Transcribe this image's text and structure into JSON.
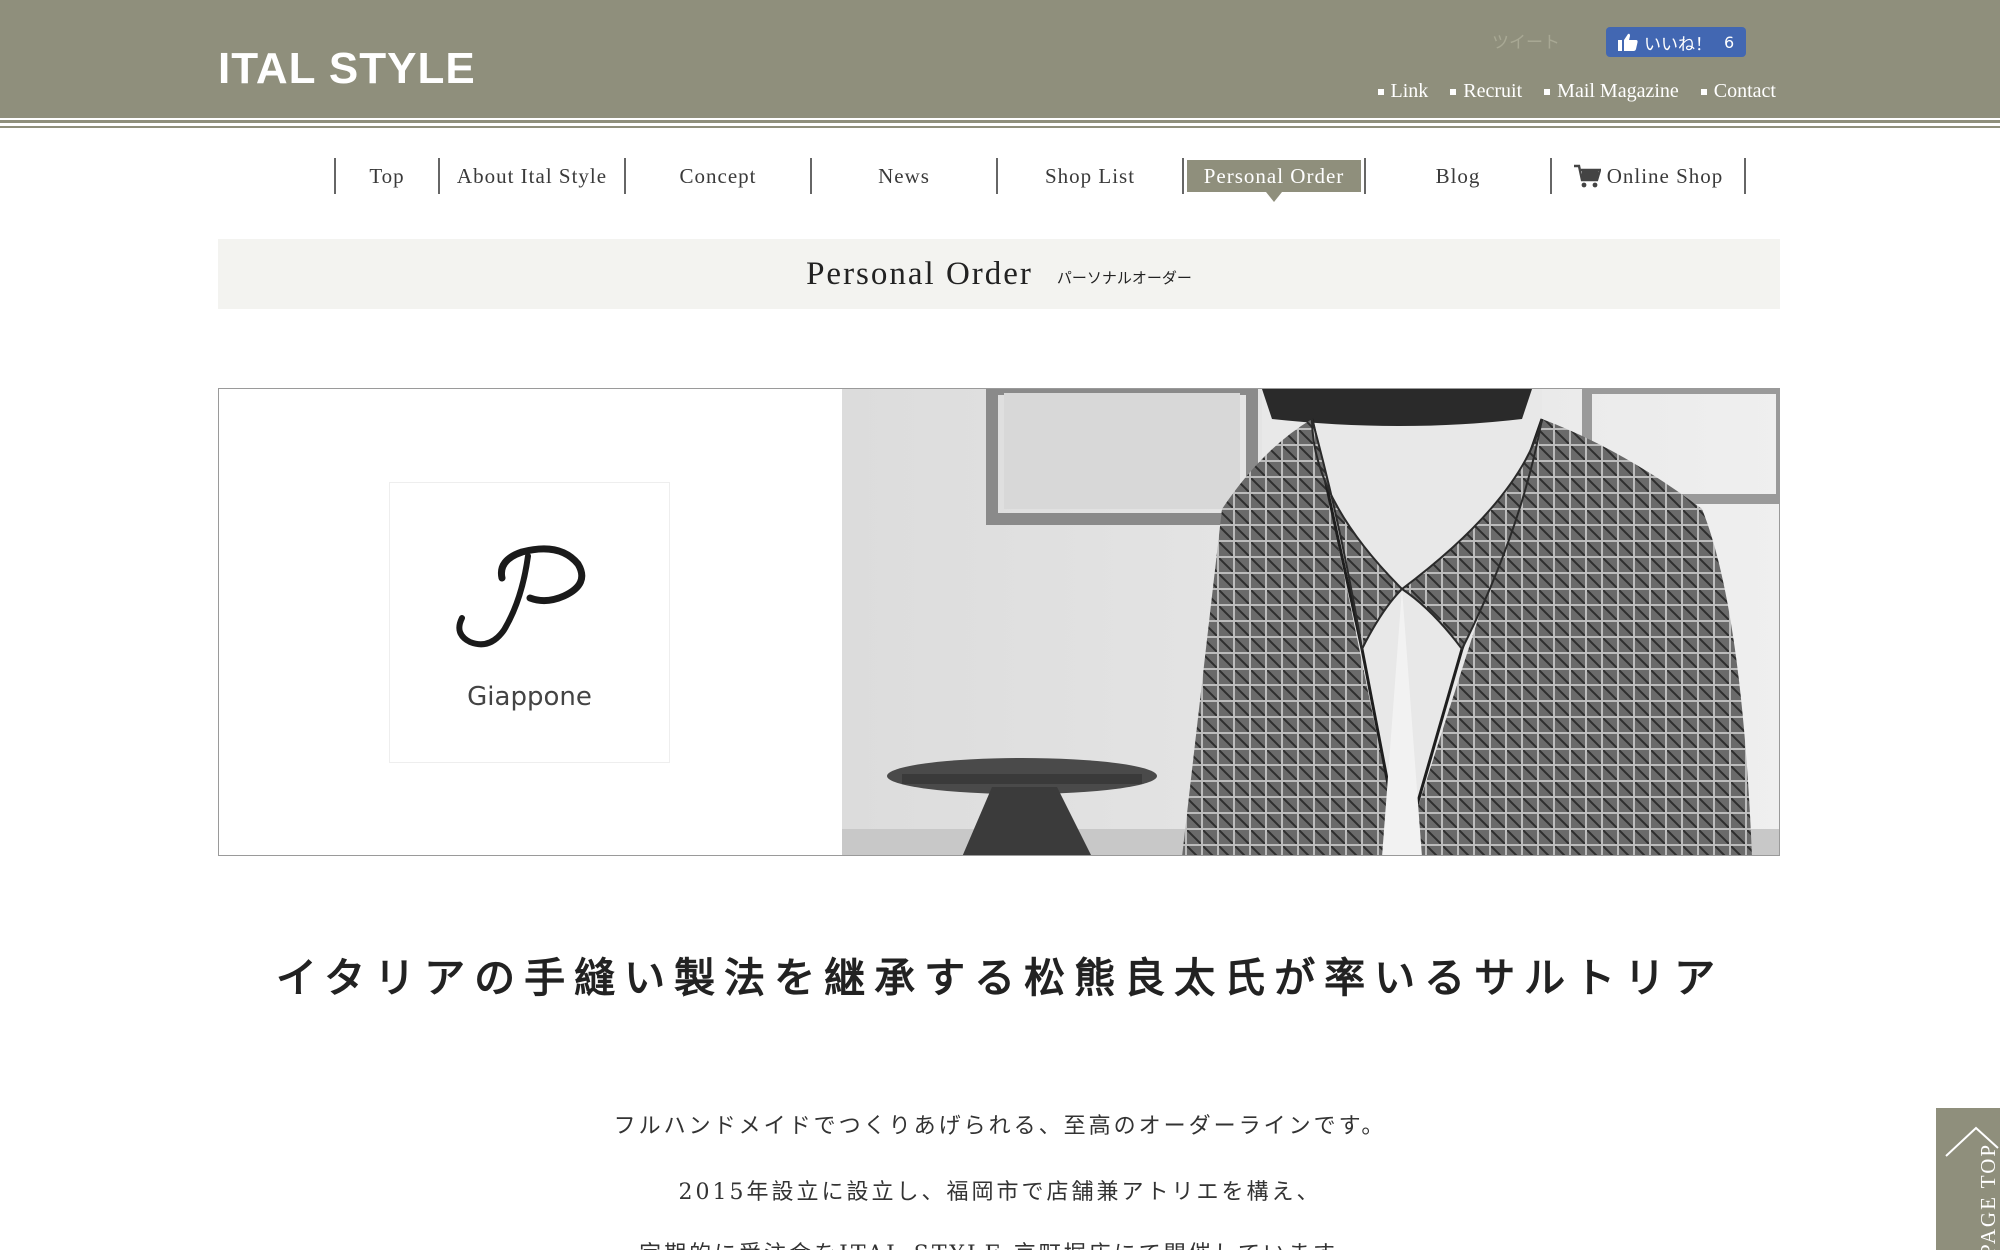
{
  "header": {
    "logo": "ITAL STYLE",
    "tweet_label": "ツイート",
    "fb_like": {
      "label": "いいね！",
      "count": "6"
    },
    "util_links": [
      "Link",
      "Recruit",
      "Mail Magazine",
      "Contact"
    ]
  },
  "nav": {
    "items": [
      "Top",
      "About Ital Style",
      "Concept",
      "News",
      "Shop List",
      "Personal Order",
      "Blog",
      "Online Shop"
    ],
    "active": "Personal Order"
  },
  "page_title": {
    "en": "Personal Order",
    "jp": "パーソナルオーダー"
  },
  "hero": {
    "brand_name": "Giappone"
  },
  "content": {
    "catch": "イタリアの手縫い製法を継承する松熊良太氏が率いるサルトリア",
    "paragraphs": [
      "フルハンドメイドでつくりあげられる、至高のオーダーラインです。",
      "2015年設立に設立し、福岡市で店舗兼アトリエを構え、",
      "定期的に受注会をITAL STYLE 京町堀店にて開催しています。"
    ]
  },
  "page_top_label": "PAGE TOP",
  "colors": {
    "header": "#8f8f7c",
    "title_bar": "#f3f3f0",
    "fb_blue": "#4267b2"
  }
}
